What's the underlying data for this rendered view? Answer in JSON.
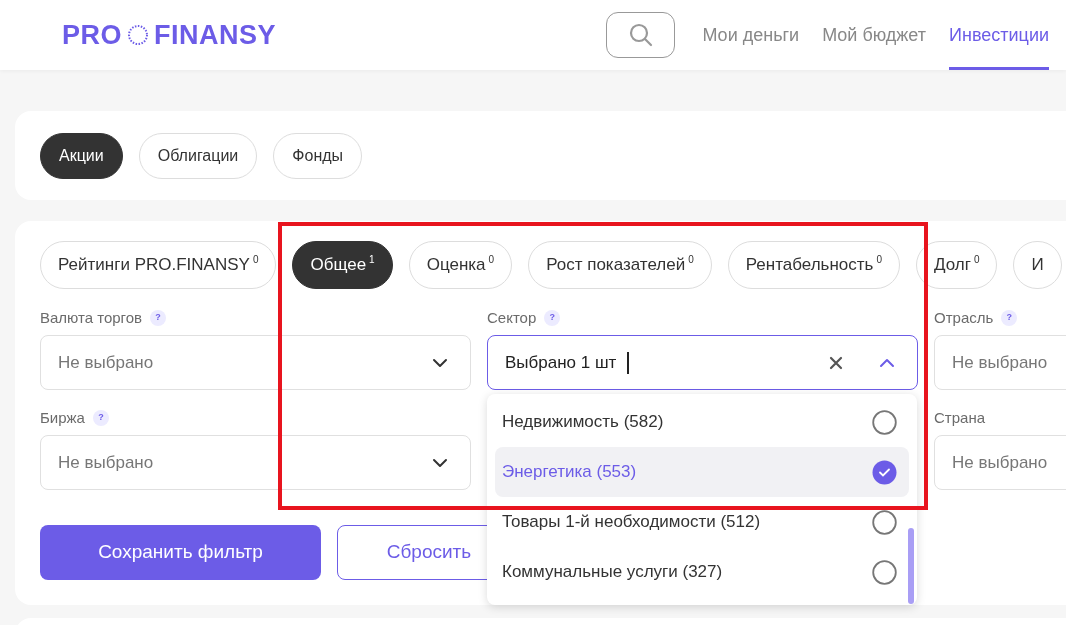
{
  "header": {
    "logo_left": "PRO",
    "logo_right": "FINANSY",
    "nav": [
      {
        "label": "Мои деньги",
        "selected": false
      },
      {
        "label": "Мой бюджет",
        "selected": false
      },
      {
        "label": "Инвестиции",
        "selected": true
      }
    ]
  },
  "asset_tabs": [
    {
      "label": "Акции",
      "selected": true
    },
    {
      "label": "Облигации",
      "selected": false
    },
    {
      "label": "Фонды",
      "selected": false
    }
  ],
  "filter_tabs": [
    {
      "label": "Рейтинги PRO.FINANSY",
      "count": "0",
      "selected": false
    },
    {
      "label": "Общее",
      "count": "1",
      "selected": true
    },
    {
      "label": "Оценка",
      "count": "0",
      "selected": false
    },
    {
      "label": "Рост показателей",
      "count": "0",
      "selected": false
    },
    {
      "label": "Рентабельность",
      "count": "0",
      "selected": false
    },
    {
      "label": "Долг",
      "count": "0",
      "selected": false
    },
    {
      "label": "И",
      "selected": false
    }
  ],
  "fields": [
    {
      "label": "Валюта торгов",
      "help": "?",
      "placeholder": "Не выбрано",
      "open": false
    },
    {
      "label": "Сектор",
      "help": "?",
      "value": "Выбрано 1 шт",
      "open": true
    },
    {
      "label": "Отрасль",
      "help": "?",
      "placeholder": "Не выбрано",
      "open": false
    },
    {
      "label": "Биржа",
      "help": "?",
      "placeholder": "Не выбрано",
      "open": false
    },
    {
      "label": "Страна",
      "placeholder": "Не выбрано",
      "open": false
    }
  ],
  "sector_options": [
    {
      "label": "Недвижимость (582)",
      "checked": false
    },
    {
      "label": "Энергетика (553)",
      "checked": true
    },
    {
      "label": "Товары 1-й необходимости (512)",
      "checked": false
    },
    {
      "label": "Коммунальные услуги (327)",
      "checked": false
    }
  ],
  "buttons": [
    {
      "label": "Сохранить фильтр",
      "kind": "primary"
    },
    {
      "label": "Сбросить",
      "kind": "secondary"
    }
  ]
}
